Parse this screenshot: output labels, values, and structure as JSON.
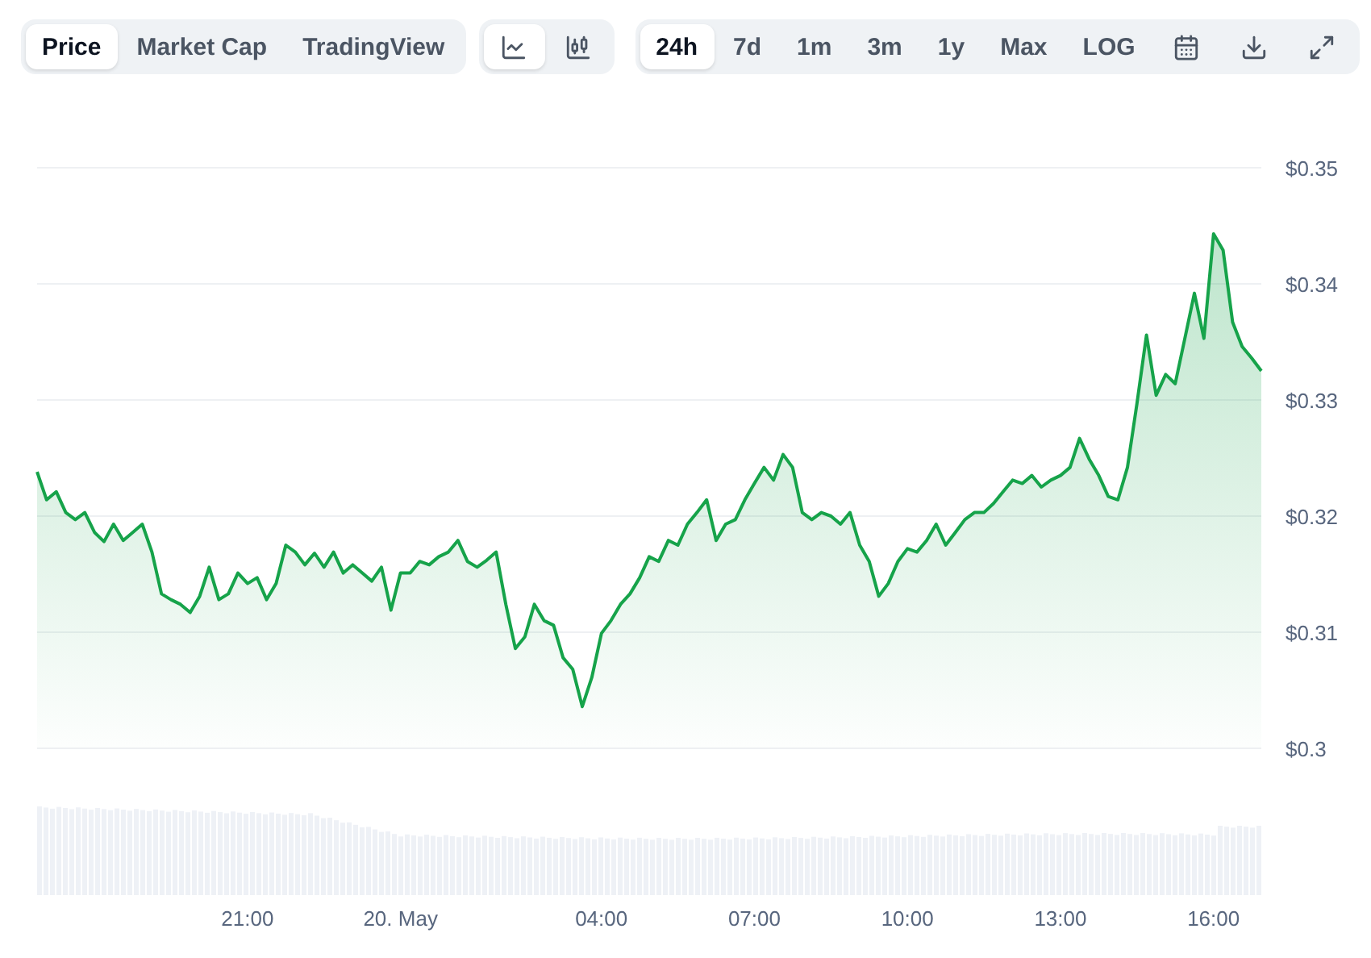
{
  "view_tabs": [
    {
      "label": "Price",
      "selected": true
    },
    {
      "label": "Market Cap",
      "selected": false
    },
    {
      "label": "TradingView",
      "selected": false
    }
  ],
  "chart_types": [
    {
      "kind": "line",
      "selected": true
    },
    {
      "kind": "candle",
      "selected": false
    }
  ],
  "ranges": [
    {
      "label": "24h",
      "selected": true
    },
    {
      "label": "7d",
      "selected": false
    },
    {
      "label": "1m",
      "selected": false
    },
    {
      "label": "3m",
      "selected": false
    },
    {
      "label": "1y",
      "selected": false
    },
    {
      "label": "Max",
      "selected": false
    },
    {
      "label": "LOG",
      "selected": false
    }
  ],
  "actions": [
    {
      "kind": "calendar"
    },
    {
      "kind": "download"
    },
    {
      "kind": "expand"
    }
  ],
  "chart": {
    "chart_data": {
      "type": "area",
      "grid": true,
      "categories": [
        null,
        null,
        null,
        null,
        null,
        null,
        null,
        null,
        null,
        null,
        null,
        null,
        null,
        null,
        null,
        null,
        null,
        null,
        null,
        null,
        null,
        null,
        "21:00",
        null,
        null,
        null,
        null,
        null,
        null,
        null,
        null,
        null,
        null,
        null,
        null,
        null,
        null,
        null,
        "20. May",
        null,
        null,
        null,
        null,
        null,
        null,
        null,
        null,
        null,
        null,
        null,
        null,
        null,
        null,
        null,
        null,
        null,
        null,
        null,
        null,
        "04:00",
        null,
        null,
        null,
        null,
        null,
        null,
        null,
        null,
        null,
        null,
        null,
        null,
        null,
        null,
        null,
        "07:00",
        null,
        null,
        null,
        null,
        null,
        null,
        null,
        null,
        null,
        null,
        null,
        null,
        null,
        null,
        null,
        "10:00",
        null,
        null,
        null,
        null,
        null,
        null,
        null,
        null,
        null,
        null,
        null,
        null,
        null,
        null,
        null,
        "13:00",
        null,
        null,
        null,
        null,
        null,
        null,
        null,
        null,
        null,
        null,
        null,
        null,
        null,
        null,
        null,
        "16:00",
        null,
        null,
        null,
        null,
        null
      ],
      "ylim": [
        0.3,
        0.35
      ],
      "yticks": [
        {
          "value": 0.35,
          "label": "$0.35"
        },
        {
          "value": 0.34,
          "label": "$0.34"
        },
        {
          "value": 0.33,
          "label": "$0.33"
        },
        {
          "value": 0.32,
          "label": "$0.32"
        },
        {
          "value": 0.31,
          "label": "$0.31"
        },
        {
          "value": 0.3,
          "label": "$0.3"
        }
      ],
      "series": [
        {
          "color": "#16a34a",
          "values": [
            0.3238,
            0.3214,
            0.3221,
            0.3203,
            0.3197,
            0.3203,
            0.3186,
            0.3178,
            0.3193,
            0.3179,
            0.3186,
            0.3193,
            0.3169,
            0.3133,
            0.3128,
            0.3124,
            0.3117,
            0.3131,
            0.3156,
            0.3128,
            0.3133,
            0.3151,
            0.3142,
            0.3147,
            0.3128,
            0.3142,
            0.3175,
            0.3169,
            0.3158,
            0.3168,
            0.3156,
            0.3169,
            0.3151,
            0.3158,
            0.3151,
            0.3144,
            0.3156,
            0.3119,
            0.3151,
            0.3151,
            0.3161,
            0.3158,
            0.3165,
            0.3169,
            0.3179,
            0.3161,
            0.3156,
            0.3162,
            0.3169,
            0.3124,
            0.3086,
            0.3096,
            0.3124,
            0.311,
            0.3106,
            0.3078,
            0.3068,
            0.3036,
            0.3061,
            0.3099,
            0.311,
            0.3124,
            0.3133,
            0.3147,
            0.3165,
            0.3161,
            0.3179,
            0.3175,
            0.3193,
            0.3203,
            0.3214,
            0.3179,
            0.3193,
            0.3197,
            0.3214,
            0.3228,
            0.3242,
            0.3231,
            0.3253,
            0.3242,
            0.3203,
            0.3197,
            0.3203,
            0.32,
            0.3193,
            0.3203,
            0.3175,
            0.3161,
            0.3131,
            0.3142,
            0.3161,
            0.3172,
            0.3169,
            0.3179,
            0.3193,
            0.3175,
            0.3186,
            0.3197,
            0.3203,
            0.3203,
            0.3211,
            0.3221,
            0.3231,
            0.3228,
            0.3235,
            0.3225,
            0.3231,
            0.3235,
            0.3242,
            0.3267,
            0.3249,
            0.3235,
            0.3217,
            0.3214,
            0.3242,
            0.3297,
            0.3356,
            0.3304,
            0.3322,
            0.3314,
            0.3353,
            0.3392,
            0.3353,
            0.3443,
            0.3429,
            0.3367,
            0.3346,
            0.3336,
            0.3325
          ]
        }
      ]
    }
  }
}
